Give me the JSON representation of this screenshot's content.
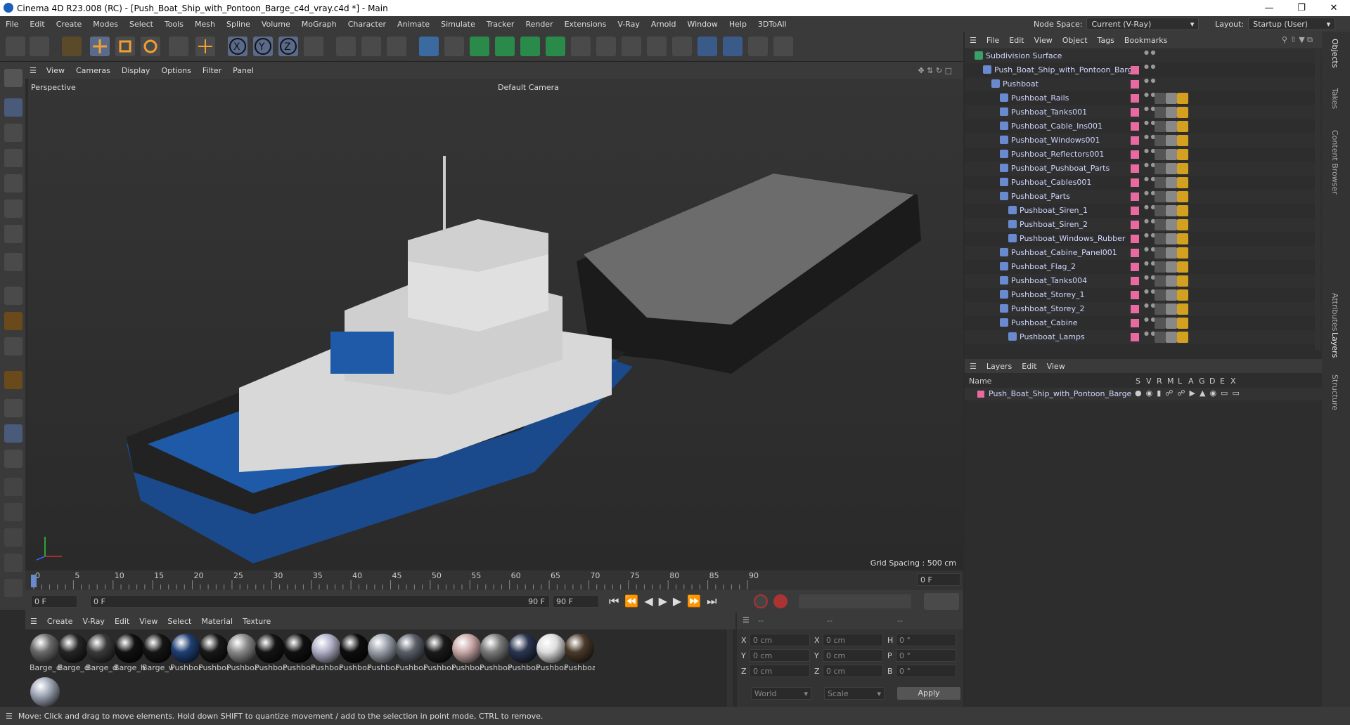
{
  "window": {
    "title": "Cinema 4D R23.008 (RC) - [Push_Boat_Ship_with_Pontoon_Barge_c4d_vray.c4d *] - Main"
  },
  "menu": [
    "File",
    "Edit",
    "Create",
    "Modes",
    "Select",
    "Tools",
    "Mesh",
    "Spline",
    "Volume",
    "MoGraph",
    "Character",
    "Animate",
    "Simulate",
    "Tracker",
    "Render",
    "Extensions",
    "V-Ray",
    "Arnold",
    "Window",
    "Help",
    "3DToAll"
  ],
  "nodespace": {
    "label": "Node Space:",
    "value": "Current (V-Ray)"
  },
  "layout": {
    "label": "Layout:",
    "value": "Startup (User)"
  },
  "viewport": {
    "menu": [
      "View",
      "Cameras",
      "Display",
      "Options",
      "Filter",
      "Panel"
    ],
    "label": "Perspective",
    "camera": "Default Camera",
    "grid": "Grid Spacing : 500 cm"
  },
  "timeline": {
    "ticks": [
      "0",
      "5",
      "10",
      "15",
      "20",
      "25",
      "30",
      "35",
      "40",
      "45",
      "50",
      "55",
      "60",
      "65",
      "70",
      "75",
      "80",
      "85",
      "90"
    ],
    "frame_right": "0 F"
  },
  "playbar": {
    "start": "0 F",
    "current": "0 F",
    "end_inner": "90 F",
    "end": "90 F"
  },
  "materials": {
    "menu": [
      "Create",
      "V-Ray",
      "Edit",
      "View",
      "Select",
      "Material",
      "Texture"
    ],
    "items": [
      {
        "label": "Barge_de",
        "color": "#6a6a6a"
      },
      {
        "label": "Barge_de",
        "color": "#252525"
      },
      {
        "label": "Barge_de",
        "color": "#3a3a3a"
      },
      {
        "label": "Barge_hu",
        "color": "#111"
      },
      {
        "label": "Barge_w",
        "color": "#151515"
      },
      {
        "label": "Pushboa",
        "color": "#1f3f73"
      },
      {
        "label": "Pushboa",
        "color": "#181818"
      },
      {
        "label": "Pushboa",
        "color": "#8a8a8a"
      },
      {
        "label": "Pushboa",
        "color": "#141414"
      },
      {
        "label": "Pushboa",
        "color": "#101010"
      },
      {
        "label": "Pushboa",
        "color": "#b0b0c8"
      },
      {
        "label": "Pushboa",
        "color": "#0d0d0d"
      },
      {
        "label": "Pushboa",
        "color": "#9aa0aa"
      },
      {
        "label": "Pushboa",
        "color": "#5a5f68"
      },
      {
        "label": "Pushboa",
        "color": "#1a1a1a"
      },
      {
        "label": "Pushboa",
        "color": "#c9a8a8"
      },
      {
        "label": "Pushboa",
        "color": "#7a7a7a"
      },
      {
        "label": "Pushboa",
        "color": "#2a3550"
      },
      {
        "label": "Pushboa",
        "color": "#ddd"
      },
      {
        "label": "Pushboa",
        "color": "#4a3a2a"
      },
      {
        "label": "",
        "color": "#a0a8b8"
      }
    ]
  },
  "coords": {
    "head": [
      "--",
      "--",
      "--"
    ],
    "rows": [
      {
        "a": "X",
        "v1": "0 cm",
        "b": "X",
        "v2": "0 cm",
        "c": "H",
        "v3": "0 °"
      },
      {
        "a": "Y",
        "v1": "0 cm",
        "b": "Y",
        "v2": "0 cm",
        "c": "P",
        "v3": "0 °"
      },
      {
        "a": "Z",
        "v1": "0 cm",
        "b": "Z",
        "v2": "0 cm",
        "c": "B",
        "v3": "0 °"
      }
    ],
    "world": "World",
    "scale": "Scale",
    "apply": "Apply"
  },
  "status": "Move: Click and drag to move elements. Hold down SHIFT to quantize movement / add to the selection in point mode, CTRL to remove.",
  "objects": {
    "menu": [
      "File",
      "Edit",
      "View",
      "Object",
      "Tags",
      "Bookmarks"
    ],
    "rows": [
      {
        "name": "Subdivision Surface",
        "indent": 0
      },
      {
        "name": "Push_Boat_Ship_with_Pontoon_Barge",
        "indent": 1
      },
      {
        "name": "Pushboat",
        "indent": 2
      },
      {
        "name": "Pushboat_Rails",
        "indent": 3
      },
      {
        "name": "Pushboat_Tanks001",
        "indent": 3
      },
      {
        "name": "Pushboat_Cable_Ins001",
        "indent": 3
      },
      {
        "name": "Pushboat_Windows001",
        "indent": 3
      },
      {
        "name": "Pushboat_Reflectors001",
        "indent": 3
      },
      {
        "name": "Pushboat_Pushboat_Parts",
        "indent": 3
      },
      {
        "name": "Pushboat_Cables001",
        "indent": 3
      },
      {
        "name": "Pushboat_Parts",
        "indent": 3
      },
      {
        "name": "Pushboat_Siren_1",
        "indent": 4
      },
      {
        "name": "Pushboat_Siren_2",
        "indent": 4
      },
      {
        "name": "Pushboat_Windows_Rubber",
        "indent": 4
      },
      {
        "name": "Pushboat_Cabine_Panel001",
        "indent": 3
      },
      {
        "name": "Pushboat_Flag_2",
        "indent": 3
      },
      {
        "name": "Pushboat_Tanks004",
        "indent": 3
      },
      {
        "name": "Pushboat_Storey_1",
        "indent": 3
      },
      {
        "name": "Pushboat_Storey_2",
        "indent": 3
      },
      {
        "name": "Pushboat_Cabine",
        "indent": 3
      },
      {
        "name": "Pushboat_Lamps",
        "indent": 4
      }
    ]
  },
  "layers": {
    "menu": [
      "Layers",
      "Edit",
      "View"
    ],
    "col_name": "Name",
    "cols": [
      "S",
      "V",
      "R",
      "M",
      "L",
      "A",
      "G",
      "D",
      "E",
      "X"
    ],
    "row": "Push_Boat_Ship_with_Pontoon_Barge"
  },
  "sidetabs": [
    "Objects",
    "Takes",
    "Content Browser",
    "Attributes",
    "Layers",
    "Structure"
  ]
}
